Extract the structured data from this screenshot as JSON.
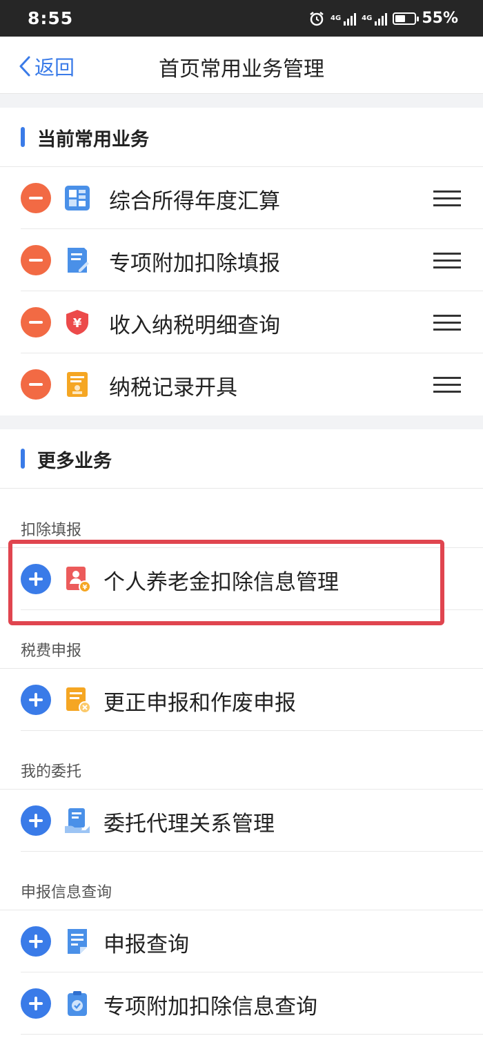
{
  "status_bar": {
    "time": "8:55",
    "network_1": "4G",
    "network_2": "4G",
    "battery": "55%",
    "battery_level": 0.55
  },
  "navbar": {
    "back_label": "返回",
    "title": "首页常用业务管理"
  },
  "current_section": {
    "title": "当前常用业务",
    "items": [
      {
        "label": "综合所得年度汇算",
        "icon": "dashboard-icon"
      },
      {
        "label": "专项附加扣除填报",
        "icon": "edit-document-icon"
      },
      {
        "label": "收入纳税明细查询",
        "icon": "tax-shield-icon"
      },
      {
        "label": "纳税记录开具",
        "icon": "certificate-icon"
      }
    ]
  },
  "more_section": {
    "title": "更多业务",
    "groups": [
      {
        "name": "扣除填报",
        "items": [
          {
            "label": "个人养老金扣除信息管理",
            "icon": "pension-card-icon",
            "highlighted": true
          }
        ]
      },
      {
        "name": "税费申报",
        "items": [
          {
            "label": "更正申报和作废申报",
            "icon": "correction-document-icon"
          }
        ]
      },
      {
        "name": "我的委托",
        "items": [
          {
            "label": "委托代理关系管理",
            "icon": "delegation-icon"
          }
        ]
      },
      {
        "name": "申报信息查询",
        "items": [
          {
            "label": "申报查询",
            "icon": "report-document-icon"
          },
          {
            "label": "专项附加扣除信息查询",
            "icon": "clipboard-check-icon"
          }
        ]
      }
    ]
  },
  "colors": {
    "accent": "#3a7be8",
    "remove": "#f26a44",
    "highlight_border": "#e0454f"
  }
}
